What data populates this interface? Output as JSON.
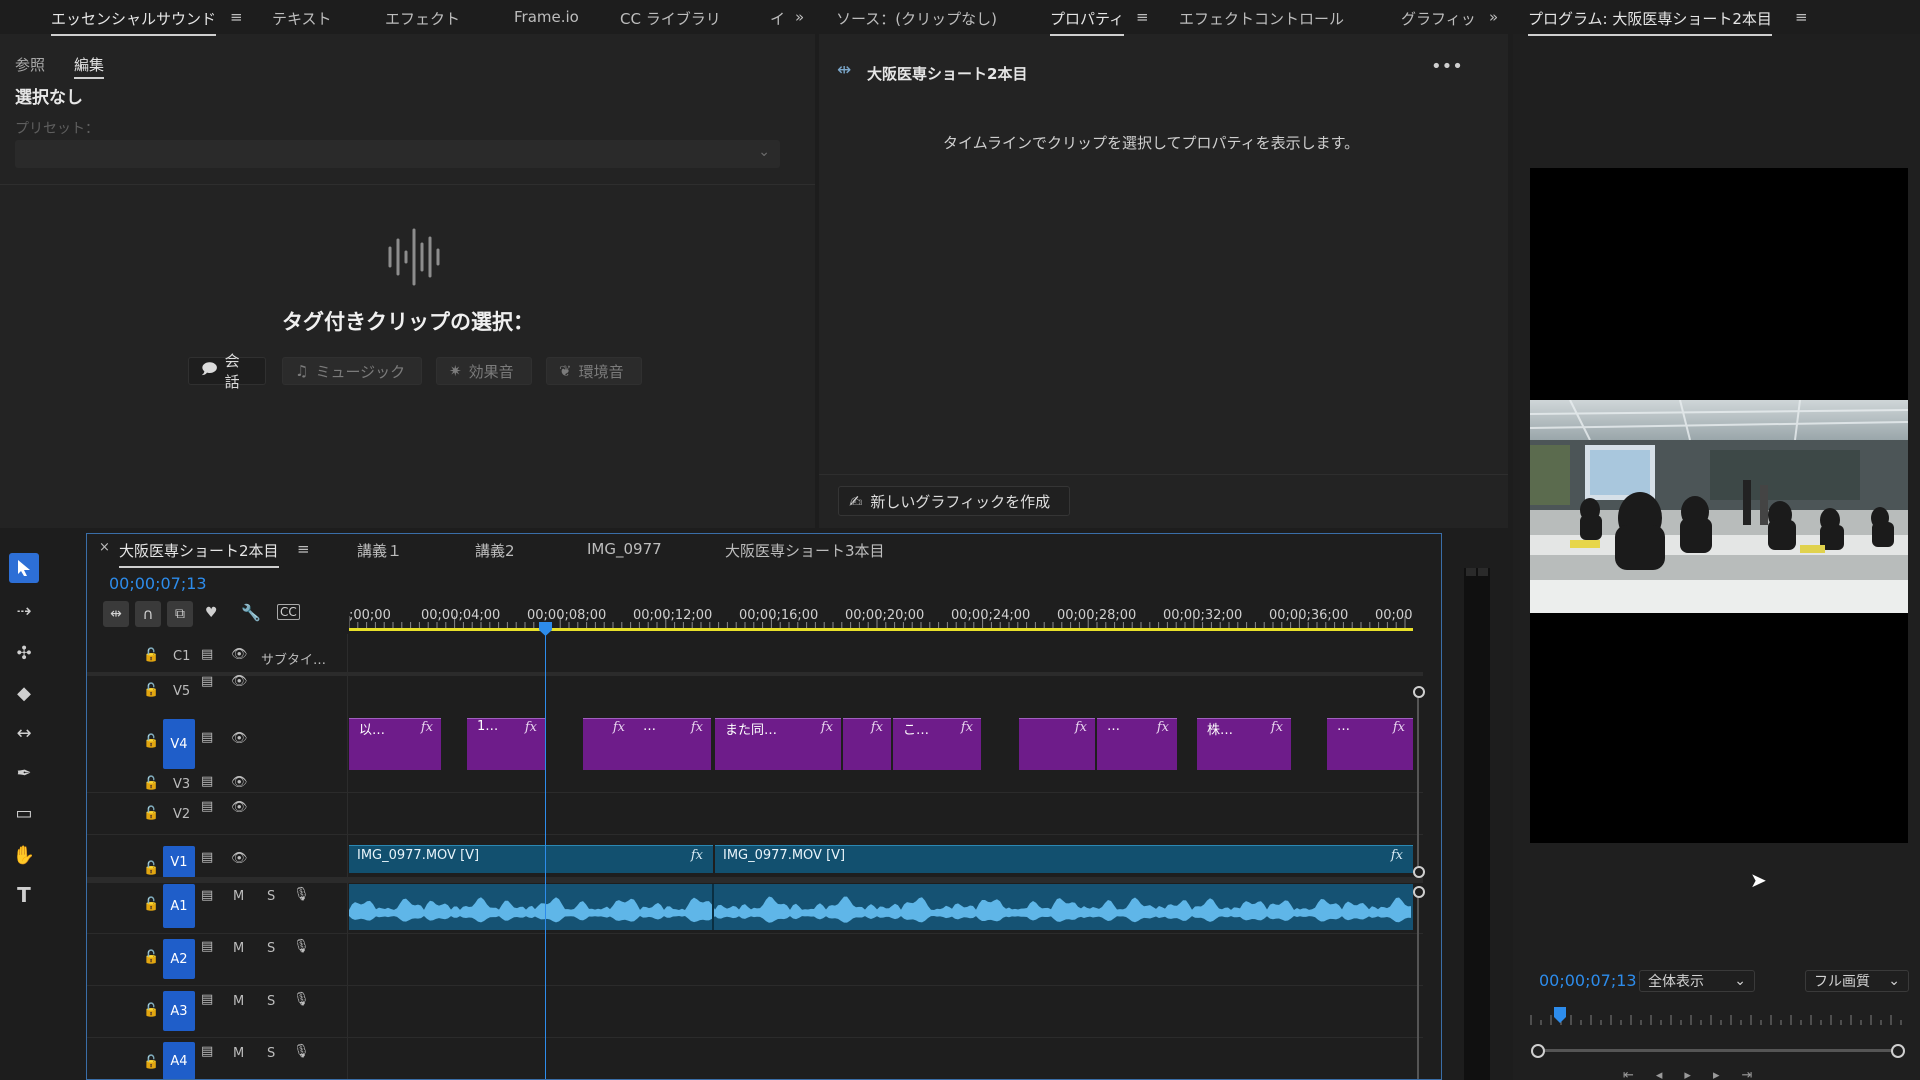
{
  "colors": {
    "accent": "#2d8ceb",
    "clip_purple": "#6e1c8a",
    "clip_blue": "#12506f",
    "audio_wave": "#5fb6e8",
    "target_blue": "#1f5ec9",
    "work_area": "#e8e02a"
  },
  "left_panel": {
    "tabs": [
      "エッセンシャルサウンド",
      "テキスト",
      "エフェクト",
      "Frame.io",
      "CC ライブラリ",
      "イ"
    ],
    "subtabs": [
      "参照",
      "編集"
    ],
    "no_selection": "選択なし",
    "preset_label": "プリセット：",
    "preset_value": "",
    "heading": "タグ付きクリップの選択：",
    "chips": [
      {
        "icon": "dialogue-icon",
        "label": "会話"
      },
      {
        "icon": "music-icon",
        "label": "ミュージック"
      },
      {
        "icon": "sfx-icon",
        "label": "効果音"
      },
      {
        "icon": "ambience-icon",
        "label": "環境音"
      }
    ]
  },
  "mid_panel": {
    "tabs": [
      "ソース：(クリップなし)",
      "プロパティ",
      "エフェクトコントロール",
      "グラフィッ"
    ],
    "sequence_name": "大阪医専ショート2本目",
    "message": "タイムラインでクリップを選択してプロパティを表示します。",
    "new_graphic": "新しいグラフィックを作成"
  },
  "program": {
    "title": "プログラム: 大阪医専ショート2本目",
    "timecode": "00;00;07;13",
    "zoom": "全体表示",
    "quality": "フル画質"
  },
  "timeline": {
    "tabs": [
      "大阪医専ショート2本目",
      "講義１",
      "講義2",
      "IMG_0977",
      "大阪医専ショート3本目"
    ],
    "timecode": "00;00;07;13",
    "ruler": [
      ";00;00",
      "00;00;04;00",
      "00;00;08;00",
      "00;00;12;00",
      "00;00;16;00",
      "00;00;20;00",
      "00;00;24;00",
      "00;00;28;00",
      "00;00;32;00",
      "00;00;36;00",
      "00;00"
    ],
    "tracks": {
      "c1": "C1",
      "c1_name": "サブタイ…",
      "v5": "V5",
      "v4": "V4",
      "v3": "V3",
      "v2": "V2",
      "v1": "V1",
      "a1": "A1",
      "a2": "A2",
      "a3": "A3",
      "a4": "A4",
      "mute": "M",
      "solo": "S"
    },
    "v4_clips": [
      "以…",
      "1…",
      "",
      "…",
      "また同…",
      "",
      "こ…",
      "",
      "…",
      "株…",
      "…"
    ],
    "v1_clips": [
      "IMG_0977.MOV [V]",
      "IMG_0977.MOV [V]"
    ],
    "fx": "fx"
  }
}
